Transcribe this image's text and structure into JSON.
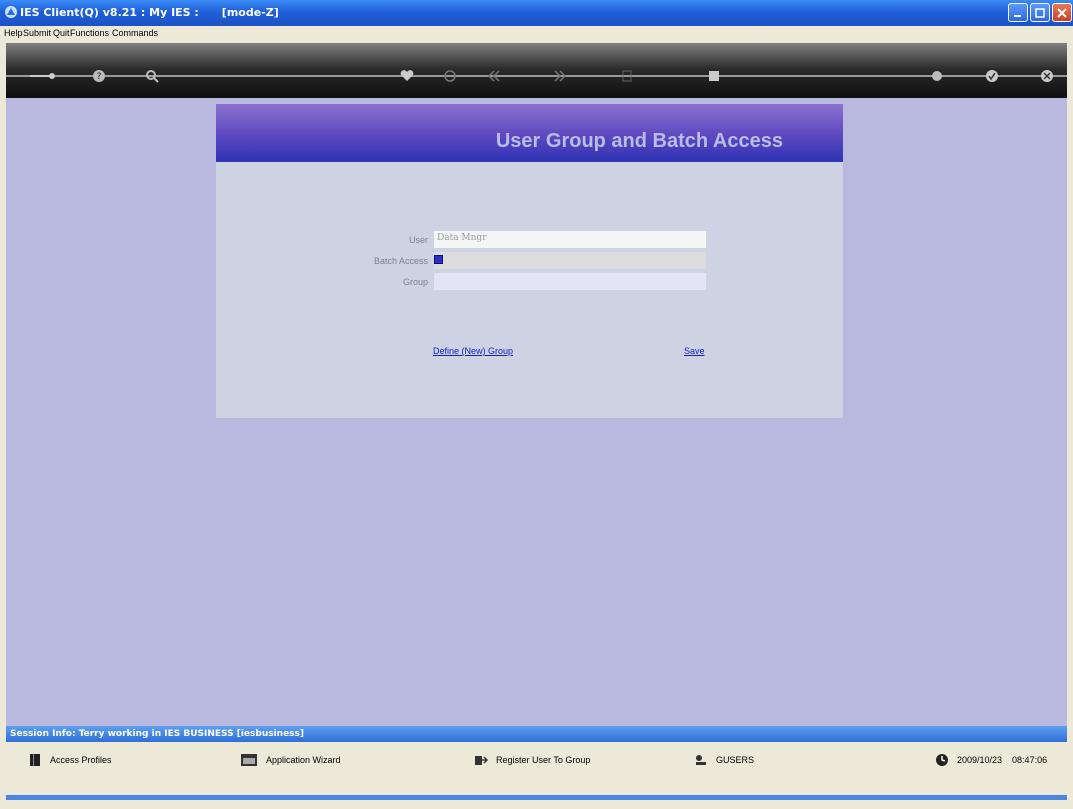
{
  "window": {
    "title": "IES Client(Q) v8.21 : My IES :      [mode-Z]"
  },
  "menu": [
    "Help",
    "Submit",
    "Quit",
    "Functions",
    "Commands"
  ],
  "toolbar": {
    "icons": [
      "key-icon",
      "help-icon",
      "search-icon",
      "heart-icon",
      "clock-icon",
      "rewind-icon",
      "forward-icon",
      "insert-icon",
      "stop-icon",
      "globe-icon",
      "check-icon",
      "close-icon"
    ]
  },
  "panel": {
    "title": "User Group and Batch Access",
    "user_label": "User",
    "user_value": "Data Mngr",
    "batch_label": "Batch Access",
    "group_label": "Group",
    "group_value": "",
    "define_link": "Define (New) Group",
    "save_link": "Save"
  },
  "session": {
    "info": "Session Info: Terry working in IES BUSINESS  [iesbusiness]"
  },
  "footer": {
    "access_profiles": "Access Profiles",
    "application_wizard": "Application Wizard",
    "register_user": "Register User To Group",
    "gusers": "GUSERS",
    "date": "2009/10/23",
    "time": "08:47:06"
  },
  "colors": {
    "titlebar": "#1f5fd9",
    "workspace": "#b9b9e0",
    "panel": "#cdd3e2",
    "panel_title": "#b8bde6",
    "link": "#1520c8"
  }
}
